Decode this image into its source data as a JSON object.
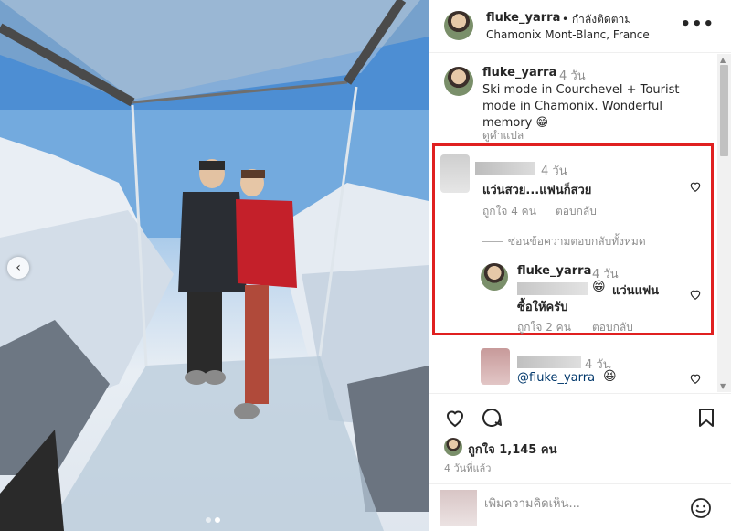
{
  "header": {
    "username": "fluke_yarra",
    "follow_status": "• กำลังติดตาม",
    "location": "Chamonix Mont-Blanc, France",
    "more_icon": "more-horizontal-icon"
  },
  "caption": {
    "username": "fluke_yarra",
    "time": "4 วัน",
    "text": "Ski mode in Courchevel + Tourist mode in Chamonix. Wonderful memory 😁",
    "translate": "ดูคำแปล"
  },
  "comments": [
    {
      "time": "4 วัน",
      "text": "แว่นสวย...แฟนก็สวย",
      "likes": "ถูกใจ 4 คน",
      "reply": "ตอบกลับ"
    }
  ],
  "hide_replies": "ซ่อนข้อความตอบกลับทั้งหมด",
  "reply": {
    "username": "fluke_yarra",
    "time": "4 วัน",
    "emoji": "😁",
    "text_line1": "แว่นแฟน",
    "text_line2": "ซื้อให้ครับ",
    "likes": "ถูกใจ 2 คน",
    "reply": "ตอบกลับ"
  },
  "comment2": {
    "time": "4 วัน",
    "mention": "@fluke_yarra",
    "emoji": "😆"
  },
  "actions": {
    "likes": "ถูกใจ 1,145 คน",
    "time": "4 วันที่แล้ว",
    "add_comment_placeholder": "เพิ่มความคิดเห็น..."
  },
  "carousel": {
    "current": 2,
    "total": 2
  },
  "colors": {
    "highlight": "#e02020",
    "muted": "#8e8e8e",
    "text": "#262626"
  }
}
